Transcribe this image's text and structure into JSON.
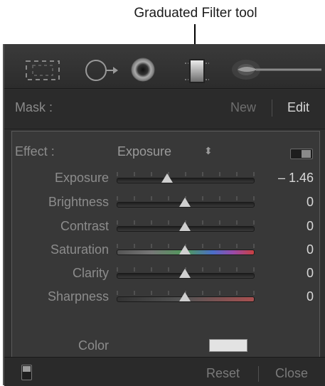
{
  "callout": {
    "text": "Graduated Filter tool"
  },
  "toolbar": {
    "tools": [
      "crop-overlay-icon",
      "spot-removal-icon",
      "red-eye-icon",
      "graduated-filter-icon",
      "adjustment-brush-icon"
    ]
  },
  "mask": {
    "label": "Mask :",
    "new_label": "New",
    "edit_label": "Edit"
  },
  "effect": {
    "label": "Effect :",
    "value": "Exposure",
    "arrows": "⬍"
  },
  "sliders": [
    {
      "label": "Exposure",
      "value": "– 1.46",
      "position": 0.37,
      "track": "plain"
    },
    {
      "label": "Brightness",
      "value": "0",
      "position": 0.5,
      "track": "plain"
    },
    {
      "label": "Contrast",
      "value": "0",
      "position": 0.5,
      "track": "plain"
    },
    {
      "label": "Saturation",
      "value": "0",
      "position": 0.5,
      "track": "saturation"
    },
    {
      "label": "Clarity",
      "value": "0",
      "position": 0.5,
      "track": "plain"
    },
    {
      "label": "Sharpness",
      "value": "0",
      "position": 0.5,
      "track": "sharpness"
    }
  ],
  "color": {
    "label": "Color",
    "swatch": "#e3e3e3"
  },
  "footer": {
    "reset_label": "Reset",
    "close_label": "Close"
  },
  "colors": {
    "panel_bg": "#2f2f2f",
    "control_bg": "#383838",
    "text_dim": "#8c8c8c",
    "text_bright": "#d8d8d8"
  }
}
